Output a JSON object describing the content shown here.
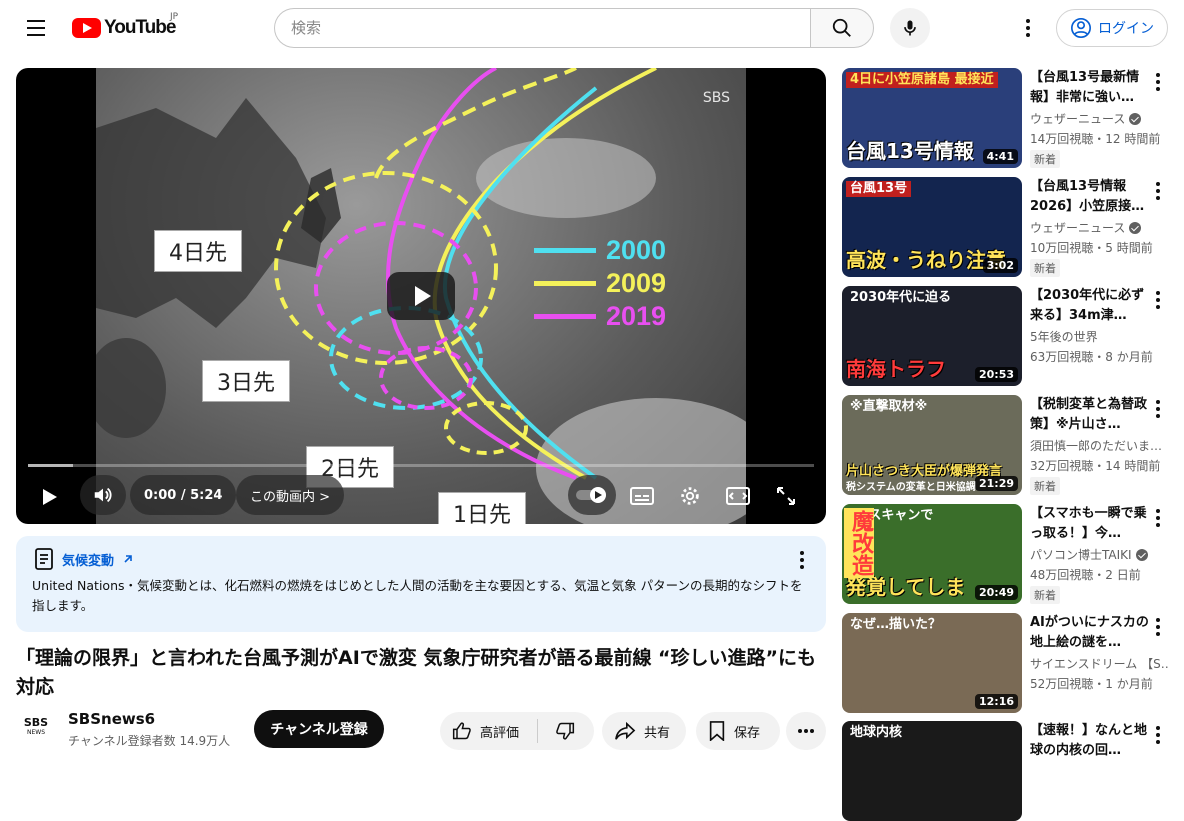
{
  "header": {
    "logo_text": "YouTube",
    "country": "JP",
    "search_placeholder": "検索",
    "login_label": "ログイン"
  },
  "player": {
    "time": "0:00 / 5:24",
    "chapter_label": "この動画内 >",
    "progress_fraction": 0.057,
    "frame": {
      "watermark": "SBS",
      "labels": [
        "4日先",
        "3日先",
        "2日先",
        "1日先"
      ],
      "legend": [
        {
          "year": "2000",
          "color": "#4fe0f0"
        },
        {
          "year": "2009",
          "color": "#f4f15a"
        },
        {
          "year": "2019",
          "color": "#e84ff0"
        }
      ]
    }
  },
  "description": {
    "topic": "気候変動",
    "source": "United Nations",
    "text": "・気候変動とは、化石燃料の燃焼をはじめとした人間の活動を主な要因とする、気温と気象 パターンの長期的なシフトを指します。"
  },
  "video": {
    "title": "「理論の限界」と言われた台風予測がAIで激変 気象庁研究者が語る最前線 “珍しい進路”にも対応",
    "channel_avatar_text": "SBS",
    "channel_avatar_sub": "NEWS",
    "channel_name": "SBSnews6",
    "subscribers": "チャンネル登録者数 14.9万人",
    "subscribe_label": "チャンネル登録",
    "like_label": "高評価",
    "share_label": "共有",
    "save_label": "保存"
  },
  "sidebar": [
    {
      "title": "【台風13号最新情報】非常に強い…",
      "channel": "ウェザーニュース",
      "verified": true,
      "meta": "14万回視聴・12 時間前",
      "badge": "新着",
      "duration": "4:41",
      "thumb_caption_top": "4日に小笠原諸島 最接近",
      "thumb_caption_bottom": "台風13号情報",
      "thumb_bg": "#2a3f7a",
      "thumb_accent": "#ffffff"
    },
    {
      "title": "【台風13号情報2026】小笠原接…",
      "channel": "ウェザーニュース",
      "verified": true,
      "meta": "10万回視聴・5 時間前",
      "badge": "新着",
      "duration": "3:02",
      "thumb_caption_top": "台風13号",
      "thumb_caption_bottom": "高波・うねり注意",
      "thumb_bg": "#13254f",
      "thumb_accent": "#ffe45a"
    },
    {
      "title": "【2030年代に必ず来る】34m津…",
      "channel": "5年後の世界",
      "verified": false,
      "meta": "63万回視聴・8 か月前",
      "badge": "",
      "duration": "20:53",
      "thumb_caption_top": "2030年代に迫る",
      "thumb_caption_bottom": "南海トラフ",
      "thumb_bg": "#1c1f2b",
      "thumb_accent": "#ff3b3b"
    },
    {
      "title": "【税制変革と為替政策】※片山さ…",
      "channel": "須田慎一郎のただいま…",
      "verified": false,
      "meta": "32万回視聴・14 時間前",
      "badge": "新着",
      "duration": "21:29",
      "thumb_caption_top": "※直撃取材※",
      "thumb_caption_bottom": "片山さつき大臣が爆弾発言",
      "thumb_bg": "#6b6b5a",
      "thumb_accent": "#ffe45a"
    },
    {
      "title": "【スマホも一瞬で乗っ取る！】今…",
      "channel": "パソコン博士TAIKI",
      "verified": true,
      "meta": "48万回視聴・2 日前",
      "badge": "新着",
      "duration": "20:49",
      "thumb_caption_top": "CTスキャンで",
      "thumb_caption_bottom": "発覚してしま",
      "thumb_bg": "#3a6e2a",
      "thumb_accent": "#ffe45a"
    },
    {
      "title": "AIがついにナスカの地上絵の謎を…",
      "channel": "サイエンスドリーム 【S…",
      "verified": false,
      "meta": "52万回視聴・1 か月前",
      "badge": "",
      "duration": "12:16",
      "thumb_caption_top": "なぜ…描いた？",
      "thumb_caption_bottom": "",
      "thumb_bg": "#7a6a55",
      "thumb_accent": "#ffffff"
    },
    {
      "title": "【速報！】なんと地球の内核の回…",
      "channel": "",
      "verified": false,
      "meta": "",
      "badge": "",
      "duration": "",
      "thumb_caption_top": "地球内核",
      "thumb_caption_bottom": "",
      "thumb_bg": "#1a1a1a",
      "thumb_accent": "#ffffff"
    }
  ],
  "sidebar_extra": {
    "thumb5_side_caption": "魔改造",
    "thumb4_sub_caption": "税システムの変革と日米協調"
  }
}
